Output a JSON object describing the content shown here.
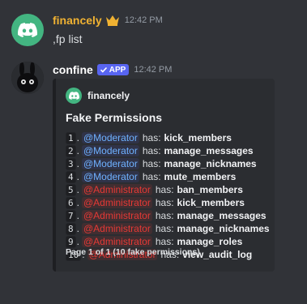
{
  "message1": {
    "username": "financely",
    "timestamp": "12:42 PM",
    "content": ",fp list",
    "username_color": "#f0b232"
  },
  "message2": {
    "username": "confine",
    "badge": "APP",
    "timestamp": "12:42 PM",
    "embed": {
      "author": "financely",
      "title": "Fake Permissions",
      "rows": [
        {
          "num": "1",
          "role": "@Moderator",
          "role_type": "mod",
          "has": "has:",
          "permission": "kick_members"
        },
        {
          "num": "2",
          "role": "@Moderator",
          "role_type": "mod",
          "has": "has:",
          "permission": "manage_messages"
        },
        {
          "num": "3",
          "role": "@Moderator",
          "role_type": "mod",
          "has": "has:",
          "permission": "manage_nicknames"
        },
        {
          "num": "4",
          "role": "@Moderator",
          "role_type": "mod",
          "has": "has:",
          "permission": "mute_members"
        },
        {
          "num": "5",
          "role": "@Administrator",
          "role_type": "admin",
          "has": "has:",
          "permission": "ban_members"
        },
        {
          "num": "6",
          "role": "@Administrator",
          "role_type": "admin",
          "has": "has:",
          "permission": "kick_members"
        },
        {
          "num": "7",
          "role": "@Administrator",
          "role_type": "admin",
          "has": "has:",
          "permission": "manage_messages"
        },
        {
          "num": "8",
          "role": "@Administrator",
          "role_type": "admin",
          "has": "has:",
          "permission": "manage_nicknames"
        },
        {
          "num": "9",
          "role": "@Administrator",
          "role_type": "admin",
          "has": "has:",
          "permission": "manage_roles"
        },
        {
          "num": "10",
          "role": "@Administrator",
          "role_type": "admin",
          "has": "has:",
          "permission": "view_audit_log"
        }
      ],
      "footer": "Page 1 of 1 (10 fake permissions)"
    }
  },
  "colors": {
    "background": "#313338",
    "embed_bg": "#2b2d31",
    "moderator": "#6eb1ff",
    "administrator": "#e53935",
    "app_badge": "#5865f2"
  }
}
